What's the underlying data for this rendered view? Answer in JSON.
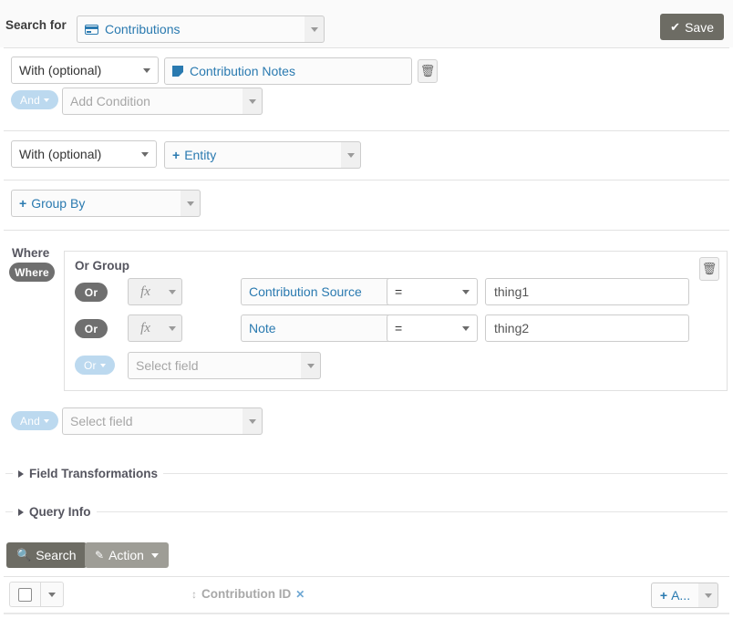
{
  "header": {
    "search_for_label": "Search for",
    "entity": {
      "icon": "credit-card-icon",
      "label": "Contributions"
    },
    "save_button": {
      "icon": "check-icon",
      "label": "Save"
    }
  },
  "join_rows": [
    {
      "join_type": "With (optional)",
      "entity": {
        "icon": "note-icon",
        "label": "Contribution Notes"
      },
      "delete_icon": "trash-icon",
      "add_condition": {
        "label": "And",
        "placeholder": "Add Condition"
      }
    },
    {
      "join_type": "With (optional)",
      "entity": {
        "icon": "plus-icon",
        "label": "Entity"
      }
    }
  ],
  "group_by": {
    "icon": "plus-icon",
    "label": "Group By"
  },
  "where": {
    "label": "Where",
    "badge": "Where",
    "group_title": "Or Group",
    "delete_icon": "trash-icon",
    "conditions": [
      {
        "operator_badge": "Or",
        "fx_label": "fx",
        "field": "Contribution Source",
        "comparison": "=",
        "value": "thing1"
      },
      {
        "operator_badge": "Or",
        "fx_label": "fx",
        "field": "Note",
        "comparison": "=",
        "value": "thing2"
      }
    ],
    "add_or_row": {
      "badge": "Or",
      "placeholder": "Select field"
    },
    "add_and_row": {
      "badge": "And",
      "placeholder": "Select field"
    }
  },
  "sections": [
    {
      "title": "Field Transformations"
    },
    {
      "title": "Query Info"
    }
  ],
  "actions": {
    "search_button": {
      "icon": "search-icon",
      "label": "Search"
    },
    "action_button": {
      "icon": "pencil-icon",
      "label": "Action"
    }
  },
  "results_table": {
    "select_all_checkbox": "select-all",
    "columns": [
      {
        "sort_icon": "sort-icon",
        "label": "Contribution ID",
        "remove_icon": "x-icon"
      }
    ],
    "add_column": {
      "icon": "plus-icon",
      "label": "A..."
    }
  },
  "colors": {
    "link_blue": "#2a7ab0",
    "pill_dark": "#6f6f6f",
    "pill_light_blue": "#bcd9ef",
    "button_dark": "#6d6c64",
    "button_mid": "#9e9d96",
    "border": "#cccccc",
    "heading": "#55555f"
  }
}
